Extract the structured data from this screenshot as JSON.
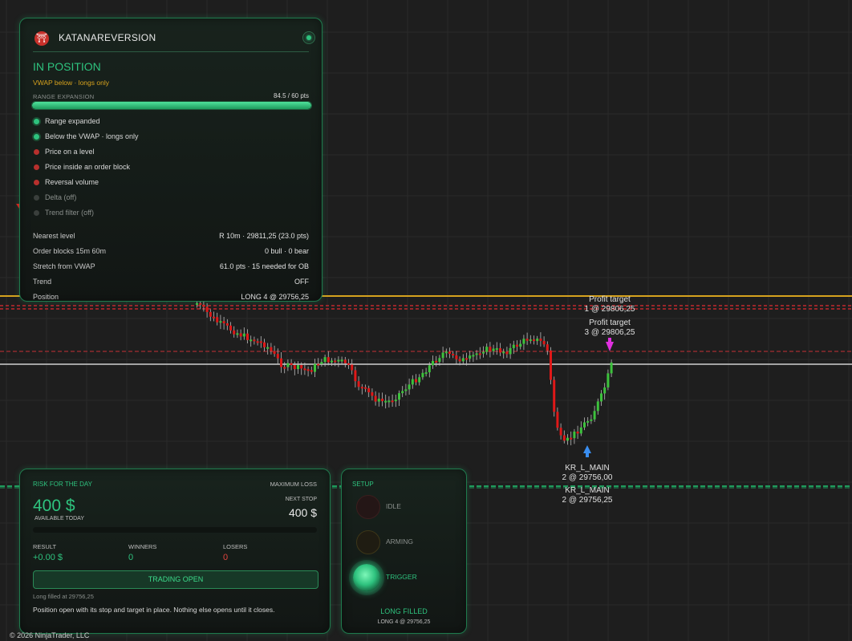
{
  "strategy": {
    "name": "KATANAREVERSION",
    "status": "IN POSITION",
    "subtitle": "VWAP below · longs only",
    "range_label": "RANGE EXPANSION",
    "range_value": "84.5 / 60 pts",
    "range_fill": 1.0,
    "checks": [
      {
        "label": "Range expanded",
        "state": "on"
      },
      {
        "label": "Below the VWAP · longs only",
        "state": "on"
      },
      {
        "label": "Price on a level",
        "state": "off"
      },
      {
        "label": "Price inside an order block",
        "state": "off"
      },
      {
        "label": "Reversal volume",
        "state": "off"
      },
      {
        "label": "Delta (off)",
        "state": "disabled"
      },
      {
        "label": "Trend filter (off)",
        "state": "disabled"
      }
    ],
    "stats": [
      {
        "key": "Nearest level",
        "value": "R 10m  ·  29811,25  (23.0 pts)"
      },
      {
        "key": "Order blocks 15m 60m",
        "value": "0 bull  ·  0 bear"
      },
      {
        "key": "Stretch from VWAP",
        "value": "61.0 pts  ·  15 needed for OB"
      },
      {
        "key": "Trend",
        "value": "OFF"
      },
      {
        "key": "Position",
        "value": "LONG 4 @ 29756,25"
      }
    ]
  },
  "risk": {
    "title": "RISK FOR THE DAY",
    "max_loss_label": "MAXIMUM LOSS",
    "amount": "400 $",
    "available_label": "AVAILABLE TODAY",
    "next_stop_label": "NEXT STOP",
    "next_stop_value": "400 $",
    "result_label": "RESULT",
    "result_value": "+0.00 $",
    "winners_label": "WINNERS",
    "winners_value": "0",
    "losers_label": "LOSERS",
    "losers_value": "0",
    "button_label": "TRADING OPEN",
    "note1": "Long filled at 29756,25",
    "note2": "Position open with its stop and target in place. Nothing else opens until it closes."
  },
  "setup": {
    "title": "SETUP",
    "steps": {
      "idle": "IDLE",
      "arming": "ARMING",
      "trigger": "TRIGGER"
    },
    "state": "LONG FILLED",
    "position": "LONG 4 @ 29756,25"
  },
  "chart_labels": {
    "pt1_title": "Profit target",
    "pt1_value": "1 @ 29806,25",
    "pt2_title": "Profit target",
    "pt2_value": "3 @ 29806,25",
    "entry1_title": "KR_L_MAIN",
    "entry1_value": "2 @ 29756,00",
    "entry2_title": "KR_L_MAIN",
    "entry2_value": "2 @ 29756,25"
  },
  "colors": {
    "bull": "#3cc23c",
    "bear": "#e01818",
    "target_line": "#d6a21e",
    "stop_line": "#c0282e",
    "price_line": "#d0d0d0",
    "level_line": "#2ec27e"
  },
  "copyright": "© 2026 NinjaTrader, LLC"
}
